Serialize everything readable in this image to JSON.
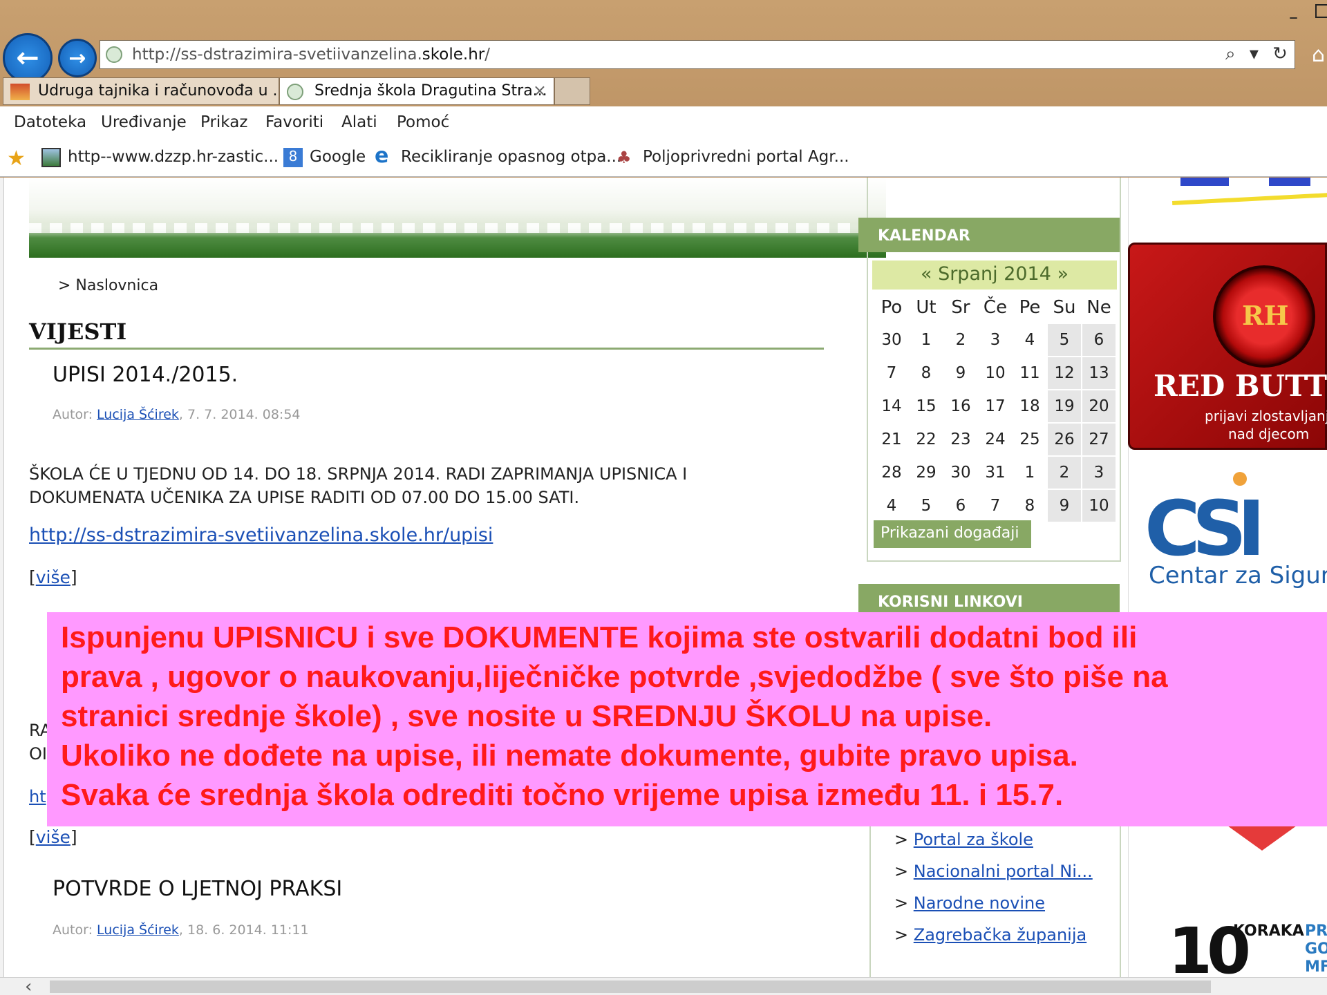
{
  "browser": {
    "address_prefix": "http://ss-dstrazimira-svetiivanzelina.",
    "address_domain": "skole.hr",
    "address_suffix": "/",
    "tabs": [
      {
        "title": "Udruga tajnika i računovođa u ...",
        "active": false
      },
      {
        "title": "Srednja škola Dragutina Stra...",
        "active": true
      }
    ],
    "tab_close": "×",
    "menu": [
      "Datoteka",
      "Uređivanje",
      "Prikaz",
      "Favoriti",
      "Alati",
      "Pomoć"
    ],
    "favorites": [
      {
        "label": "http--www.dzzp.hr-zastic...",
        "icon": "page-icon"
      },
      {
        "label": "Google",
        "icon": "google-icon"
      },
      {
        "label": "Recikliranje opasnog otpa...",
        "icon": "ie-icon"
      },
      {
        "label": "Poljoprivredni portal  Agr...",
        "icon": "plant-icon"
      }
    ],
    "addr_tools": "⌕ ▾ ↻"
  },
  "page": {
    "breadcrumb": "> Naslovnica",
    "section_title": "VIJESTI",
    "articles": [
      {
        "title": "UPISI 2014./2015.",
        "meta_prefix": "Autor: ",
        "author": "Lucija Šćirek",
        "meta_suffix": ", 7. 7. 2014. 08:54",
        "body_line1": "ŠKOLA ĆE U TJEDNU OD 14. DO 18. SRPNJA 2014. RADI ZAPRIMANJA UPISNICA I",
        "body_line2": "DOKUMENATA UČENIKA ZA UPISE RADITI OD 07.00 DO 15.00 SATI.",
        "link": "http://ss-dstrazimira-svetiivanzelina.skole.hr/upisi",
        "more_open": "[",
        "more": "više",
        "more_close": "]"
      },
      {
        "clip1": "RA",
        "clip2": "OI",
        "clip3": "ht",
        "more_open": "[",
        "more": "više",
        "more_close": "]"
      },
      {
        "title": "POTVRDE O LJETNOJ PRAKSI",
        "meta_prefix": "Autor: ",
        "author": "Lucija Šćirek",
        "meta_suffix": ", 18. 6. 2014. 11:11"
      }
    ]
  },
  "calendar": {
    "header": "KALENDAR",
    "month": "« Srpanj 2014 »",
    "weekdays": [
      "Po",
      "Ut",
      "Sr",
      "Če",
      "Pe",
      "Su",
      "Ne"
    ],
    "weeks": [
      [
        "30",
        "1",
        "2",
        "3",
        "4",
        "5",
        "6"
      ],
      [
        "7",
        "8",
        "9",
        "10",
        "11",
        "12",
        "13"
      ],
      [
        "14",
        "15",
        "16",
        "17",
        "18",
        "19",
        "20"
      ],
      [
        "21",
        "22",
        "23",
        "24",
        "25",
        "26",
        "27"
      ],
      [
        "28",
        "29",
        "30",
        "31",
        "1",
        "2",
        "3"
      ],
      [
        "4",
        "5",
        "6",
        "7",
        "8",
        "9",
        "10"
      ]
    ],
    "events_button": "Prikazani događaji"
  },
  "links": {
    "header": "KORISNI LINKOVI",
    "items": [
      "Portal za škole",
      "Nacionalni portal Ni...",
      "Narodne novine",
      "Zagrebačka županija"
    ]
  },
  "sidebar": {
    "red_button_seal": "RH",
    "red_button_title": "RED BUTT",
    "red_button_sub1": "prijavi zlostavljanje",
    "red_button_sub2": "nad djecom",
    "csi_text": "Centar za Sigurnij",
    "koraka_number": "10",
    "koraka_word": "KORAKA",
    "koraka_side": "PR\nGO\nMF"
  },
  "overlay": {
    "lines": [
      "Ispunjenu  UPISNICU  i sve DOKUMENTE  kojima ste ostvarili  dodatni bod ili",
      "prava , ugovor o naukovanju,liječničke potvrde ,svjedodžbe  ( sve što piše na",
      "stranici srednje škole)  , sve nosite u SREDNJU  ŠKOLU  na upise.",
      "Ukoliko ne dođete na upise, ili nemate dokumente, gubite pravo upisa.",
      "Svaka će srednja škola odrediti točno vrijeme upisa između 11. i 15.7."
    ]
  },
  "colors": {
    "chrome": "#c29a6e",
    "green_header": "#88a864",
    "link": "#1a4fb5",
    "overlay_bg": "#ff99ff",
    "overlay_text": "#ff1a1a"
  }
}
